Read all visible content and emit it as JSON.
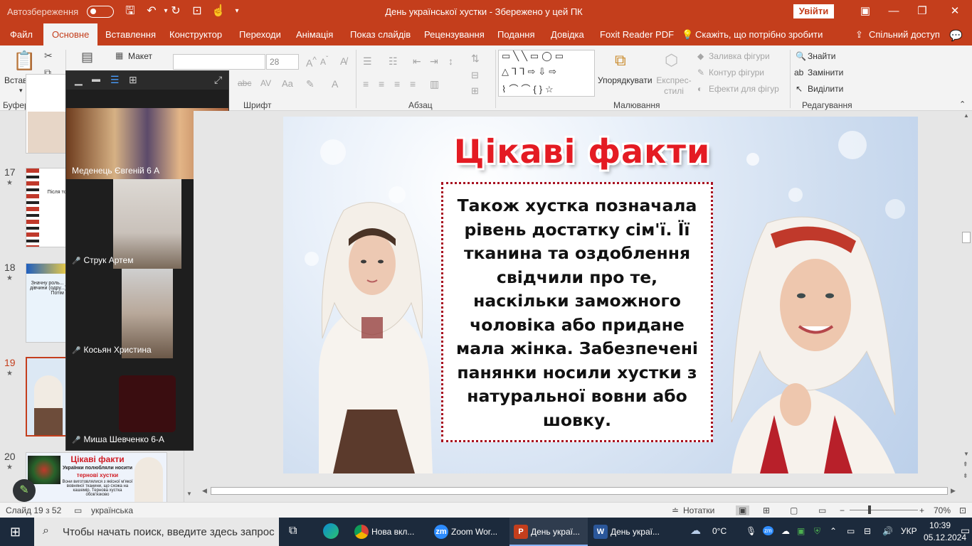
{
  "titlebar": {
    "autosave_label": "Автозбереження",
    "document_title": "День української хустки  -  Збережено у цей ПК",
    "login_button": "Увійти"
  },
  "menubar": {
    "tabs": [
      "Файл",
      "Основне",
      "Вставлення",
      "Конструктор",
      "Переходи",
      "Анімація",
      "Показ слайдів",
      "Рецензування",
      "Подання",
      "Довідка",
      "Foxit Reader PDF"
    ],
    "tell_me": "Скажіть, що потрібно зробити",
    "share": "Спільний доступ"
  },
  "ribbon": {
    "clipboard": {
      "paste": "Вставити",
      "label": "Буфер обміну"
    },
    "slides": {
      "layout": "Макет"
    },
    "font": {
      "size": "28",
      "label": "Шрифт"
    },
    "paragraph": {
      "label": "Абзац"
    },
    "drawing": {
      "arrange": "Упорядкувати",
      "quick_styles": "Експрес-стилі",
      "fill": "Заливка фігури",
      "outline": "Контур фігури",
      "effects": "Ефекти для фігур",
      "label": "Малювання"
    },
    "editing": {
      "find": "Знайти",
      "replace": "Замінити",
      "select": "Виділити",
      "label": "Редагування"
    }
  },
  "thumbnails": [
    {
      "num": "",
      "text": ""
    },
    {
      "num": "17",
      "text": "Після того, як дівчина виходила заміж... «засв... вол...»"
    },
    {
      "num": "18",
      "text": "Значну роль... під час весіл... дівчини (одру...) чоботи, нам... Потім нею..."
    },
    {
      "num": "19",
      "text": "Ці..."
    },
    {
      "num": "20",
      "text_title": "Цікаві факти",
      "text_sub": "Українки полюбляли носити",
      "text_red": "тернові хустки",
      "text": "Вони виготовлялися з якісної м'якої вовняної тканини, що схожа на кашемір. Тернова хустка обов'язково"
    }
  ],
  "zoom": {
    "participants": [
      {
        "name": "Меденець Євгеній 6 А",
        "muted": false
      },
      {
        "name": "Струк Артем",
        "muted": true
      },
      {
        "name": "Косьян Христина",
        "muted": true
      },
      {
        "name": "Миша Шевченко 6-А",
        "muted": true
      }
    ]
  },
  "slide": {
    "title": "Цікаві факти",
    "body": "Також хустка позначала рівень достатку сім'ї. Її тканина та оздоблення свідчили про те, наскільки заможного чоловіка або придане мала жінка. Забезпечені панянки носили хустки з натуральної вовни або шовку."
  },
  "statusbar": {
    "slide_info": "Слайд 19 з 52",
    "language": "українська",
    "notes": "Нотатки",
    "zoom_level": "70%"
  },
  "taskbar": {
    "search_placeholder": "Чтобы начать поиск, введите здесь запрос",
    "apps": [
      {
        "label": "Нова вкл...",
        "icon": "chrome-icon"
      },
      {
        "label": "Zoom Wor...",
        "icon": "zoom-icon"
      },
      {
        "label": "День украї...",
        "icon": "powerpoint-icon"
      },
      {
        "label": "День украї...",
        "icon": "word-icon"
      }
    ],
    "temperature": "0°C",
    "lang": "УКР",
    "time": "10:39",
    "date": "05.12.2024"
  }
}
